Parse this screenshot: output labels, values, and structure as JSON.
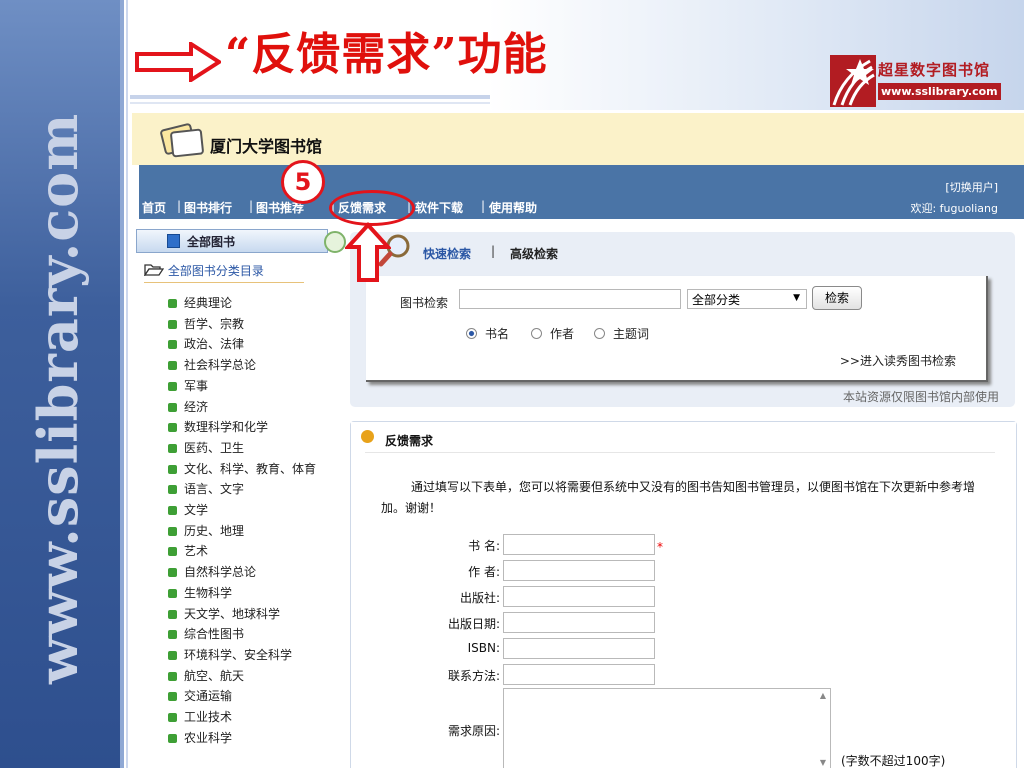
{
  "slide": {
    "title": "“反馈需求”功能",
    "vertical_watermark": "www.sslibrary.com",
    "logo": {
      "name": "超星数字图书馆",
      "url": "www.sslibrary.com"
    },
    "step_number": "5"
  },
  "site": {
    "library_name": "厦门大学图书馆",
    "nav": [
      "首页",
      "|",
      "图书排行",
      "|",
      "图书推荐",
      "|",
      "反馈需求",
      "|",
      "软件下载",
      "|",
      "使用帮助"
    ],
    "switch_user": "[切换用户]",
    "welcome": "欢迎: fuguoliang"
  },
  "sidebar": {
    "tab_label": "全部图书",
    "all_categories": "全部图书分类目录",
    "categories": [
      "经典理论",
      "哲学、宗教",
      "政治、法律",
      "社会科学总论",
      "军事",
      "经济",
      "数理科学和化学",
      "医药、卫生",
      "文化、科学、教育、体育",
      "语言、文字",
      "文学",
      "历史、地理",
      "艺术",
      "自然科学总论",
      "生物科学",
      "天文学、地球科学",
      "综合性图书",
      "环境科学、安全科学",
      "航空、航天",
      "交通运输",
      "工业技术",
      "农业科学"
    ]
  },
  "search": {
    "tab_quick": "快速检索",
    "tab_sep": "|",
    "tab_advanced": "高级检索",
    "label": "图书检索",
    "input_value": "",
    "category_selected": "全部分类",
    "button": "检索",
    "radios": [
      {
        "label": "书名",
        "checked": true
      },
      {
        "label": "作者",
        "checked": false
      },
      {
        "label": "主题词",
        "checked": false
      }
    ],
    "fine_link": ">>进入读秀图书检索",
    "notice": "本站资源仅限图书馆内部使用"
  },
  "feedback": {
    "title": "反馈需求",
    "intro": "通过填写以下表单，您可以将需要但系统中又没有的图书告知图书管理员，以便图书馆在下次更新中参考增加。谢谢！",
    "fields": [
      {
        "label": "书 名:",
        "value": "",
        "required_mark": "*"
      },
      {
        "label": "作 者:",
        "value": ""
      },
      {
        "label": "出版社:",
        "value": ""
      },
      {
        "label": "出版日期:",
        "value": ""
      },
      {
        "label": "ISBN:",
        "value": ""
      },
      {
        "label": "联系方法:",
        "value": ""
      }
    ],
    "reason_label": "需求原因:",
    "reason_value": "",
    "limit_note": "(字数不超过100字)"
  },
  "colors": {
    "title_red": "#e0100c",
    "nav_blue": "#4a74a6",
    "header_cream": "#fbf2c9",
    "highlight_red": "#e3141b"
  }
}
